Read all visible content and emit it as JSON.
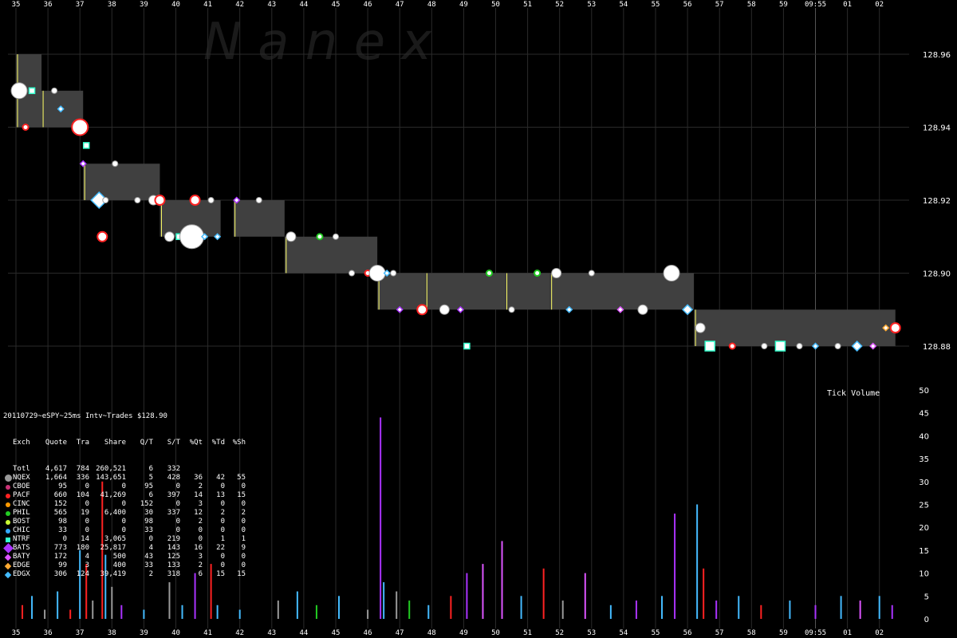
{
  "watermark": "N a n e x",
  "stats_title": "20110729~eSPY~25ms Intv~Trades $128.90",
  "stats_header": [
    "Exch",
    "Quote",
    "Tra",
    "Share",
    "Q/T",
    "S/T",
    "%Qt",
    "%Td",
    "%Sh"
  ],
  "stats_rows": [
    {
      "exch": "Totl",
      "quote": "4,617",
      "tra": "784",
      "share": "260,521",
      "qt": "6",
      "st": "332",
      "pqt": "",
      "ptd": "",
      "psh": "",
      "color": "",
      "marker": "none"
    },
    {
      "exch": "NQEX",
      "quote": "1,664",
      "tra": "336",
      "share": "143,651",
      "qt": "5",
      "st": "428",
      "pqt": "36",
      "ptd": "42",
      "psh": "55",
      "color": "#999999",
      "marker": "circle-big"
    },
    {
      "exch": "CBOE",
      "quote": "95",
      "tra": "0",
      "share": "0",
      "qt": "95",
      "st": "0",
      "pqt": "2",
      "ptd": "0",
      "psh": "0",
      "color": "#cc3377",
      "marker": "circle"
    },
    {
      "exch": "PACF",
      "quote": "660",
      "tra": "104",
      "share": "41,269",
      "qt": "6",
      "st": "397",
      "pqt": "14",
      "ptd": "13",
      "psh": "15",
      "color": "#ff2222",
      "marker": "circle"
    },
    {
      "exch": "CINC",
      "quote": "152",
      "tra": "0",
      "share": "0",
      "qt": "152",
      "st": "0",
      "pqt": "3",
      "ptd": "0",
      "psh": "0",
      "color": "#ff9900",
      "marker": "circle"
    },
    {
      "exch": "PHIL",
      "quote": "565",
      "tra": "19",
      "share": "6,400",
      "qt": "30",
      "st": "337",
      "pqt": "12",
      "ptd": "2",
      "psh": "2",
      "color": "#22cc22",
      "marker": "circle"
    },
    {
      "exch": "BOST",
      "quote": "98",
      "tra": "0",
      "share": "0",
      "qt": "98",
      "st": "0",
      "pqt": "2",
      "ptd": "0",
      "psh": "0",
      "color": "#ccff33",
      "marker": "circle"
    },
    {
      "exch": "CHIC",
      "quote": "33",
      "tra": "0",
      "share": "0",
      "qt": "33",
      "st": "0",
      "pqt": "0",
      "ptd": "0",
      "psh": "0",
      "color": "#33aaff",
      "marker": "circle"
    },
    {
      "exch": "NTRF",
      "quote": "0",
      "tra": "14",
      "share": "3,065",
      "qt": "0",
      "st": "219",
      "pqt": "0",
      "ptd": "1",
      "psh": "1",
      "color": "#33ffcc",
      "marker": "square"
    },
    {
      "exch": "BATS",
      "quote": "773",
      "tra": "180",
      "share": "25,817",
      "qt": "4",
      "st": "143",
      "pqt": "16",
      "ptd": "22",
      "psh": "9",
      "color": "#aa33ff",
      "marker": "diamond-big"
    },
    {
      "exch": "BATY",
      "quote": "172",
      "tra": "4",
      "share": "500",
      "qt": "43",
      "st": "125",
      "pqt": "3",
      "ptd": "0",
      "psh": "0",
      "color": "#dd55ff",
      "marker": "diamond"
    },
    {
      "exch": "EDGE",
      "quote": "99",
      "tra": "3",
      "share": "400",
      "qt": "33",
      "st": "133",
      "pqt": "2",
      "ptd": "0",
      "psh": "0",
      "color": "#ffaa33",
      "marker": "diamond"
    },
    {
      "exch": "EDGX",
      "quote": "306",
      "tra": "124",
      "share": "39,419",
      "qt": "2",
      "st": "318",
      "pqt": "6",
      "ptd": "15",
      "psh": "15",
      "color": "#44bbff",
      "marker": "diamond"
    }
  ],
  "chart_data": [
    {
      "type": "scatter",
      "x_tick_labels": [
        "35",
        "36",
        "37",
        "38",
        "39",
        "40",
        "41",
        "42",
        "43",
        "44",
        "45",
        "46",
        "47",
        "48",
        "49",
        "50",
        "51",
        "52",
        "53",
        "54",
        "55",
        "56",
        "57",
        "58",
        "59",
        "09:55",
        "01",
        "02"
      ],
      "y_tick_labels": [
        "128.96",
        "128.94",
        "128.92",
        "128.90",
        "128.88"
      ],
      "ylim": [
        128.875,
        128.97
      ],
      "nbbo_spread": [
        {
          "t0": 0.0,
          "t1": 0.8,
          "bid": 128.94,
          "ask": 128.96
        },
        {
          "t0": 0.8,
          "t1": 2.1,
          "bid": 128.94,
          "ask": 128.95
        },
        {
          "t0": 2.1,
          "t1": 4.5,
          "bid": 128.92,
          "ask": 128.93
        },
        {
          "t0": 4.5,
          "t1": 6.4,
          "bid": 128.91,
          "ask": 128.92
        },
        {
          "t0": 6.8,
          "t1": 8.4,
          "bid": 128.91,
          "ask": 128.92
        },
        {
          "t0": 8.4,
          "t1": 11.3,
          "bid": 128.9,
          "ask": 128.91
        },
        {
          "t0": 11.3,
          "t1": 12.8,
          "bid": 128.89,
          "ask": 128.9
        },
        {
          "t0": 12.8,
          "t1": 15.3,
          "bid": 128.89,
          "ask": 128.9
        },
        {
          "t0": 15.3,
          "t1": 16.7,
          "bid": 128.89,
          "ask": 128.9
        },
        {
          "t0": 16.7,
          "t1": 21.2,
          "bid": 128.89,
          "ask": 128.9
        },
        {
          "t0": 21.2,
          "t1": 27.5,
          "bid": 128.88,
          "ask": 128.89
        }
      ],
      "trades": [
        {
          "t": 0.1,
          "p": 128.95,
          "exch": "NQEX",
          "size": "l"
        },
        {
          "t": 0.3,
          "p": 128.94,
          "exch": "PACF",
          "size": "s"
        },
        {
          "t": 0.5,
          "p": 128.95,
          "exch": "NTRF",
          "size": "s"
        },
        {
          "t": 1.2,
          "p": 128.95,
          "exch": "NQEX",
          "size": "s"
        },
        {
          "t": 1.4,
          "p": 128.945,
          "exch": "EDGX",
          "size": "s"
        },
        {
          "t": 2.0,
          "p": 128.94,
          "exch": "PACF",
          "size": "l"
        },
        {
          "t": 2.2,
          "p": 128.935,
          "exch": "NTRF",
          "size": "s"
        },
        {
          "t": 2.1,
          "p": 128.93,
          "exch": "BATS",
          "size": "s"
        },
        {
          "t": 2.6,
          "p": 128.92,
          "exch": "EDGX",
          "size": "l"
        },
        {
          "t": 2.8,
          "p": 128.92,
          "exch": "NQEX",
          "size": "s"
        },
        {
          "t": 2.7,
          "p": 128.91,
          "exch": "PACF",
          "size": "m"
        },
        {
          "t": 3.1,
          "p": 128.93,
          "exch": "NQEX",
          "size": "s"
        },
        {
          "t": 3.8,
          "p": 128.92,
          "exch": "NQEX",
          "size": "s"
        },
        {
          "t": 4.3,
          "p": 128.92,
          "exch": "NQEX",
          "size": "m"
        },
        {
          "t": 4.5,
          "p": 128.92,
          "exch": "PACF",
          "size": "m"
        },
        {
          "t": 4.8,
          "p": 128.91,
          "exch": "NQEX",
          "size": "m"
        },
        {
          "t": 5.1,
          "p": 128.91,
          "exch": "NTRF",
          "size": "s"
        },
        {
          "t": 5.5,
          "p": 128.91,
          "exch": "NQEX",
          "size": "xl"
        },
        {
          "t": 5.9,
          "p": 128.91,
          "exch": "EDGX",
          "size": "s"
        },
        {
          "t": 6.3,
          "p": 128.91,
          "exch": "EDGX",
          "size": "s"
        },
        {
          "t": 5.6,
          "p": 128.92,
          "exch": "PACF",
          "size": "m"
        },
        {
          "t": 6.1,
          "p": 128.92,
          "exch": "NQEX",
          "size": "s"
        },
        {
          "t": 6.9,
          "p": 128.92,
          "exch": "BATS",
          "size": "s"
        },
        {
          "t": 7.6,
          "p": 128.92,
          "exch": "NQEX",
          "size": "s"
        },
        {
          "t": 8.6,
          "p": 128.91,
          "exch": "NQEX",
          "size": "m"
        },
        {
          "t": 9.5,
          "p": 128.91,
          "exch": "PHIL",
          "size": "s"
        },
        {
          "t": 10.0,
          "p": 128.91,
          "exch": "NQEX",
          "size": "s"
        },
        {
          "t": 10.5,
          "p": 128.9,
          "exch": "NQEX",
          "size": "s"
        },
        {
          "t": 11.0,
          "p": 128.9,
          "exch": "PACF",
          "size": "s"
        },
        {
          "t": 11.3,
          "p": 128.9,
          "exch": "NQEX",
          "size": "l"
        },
        {
          "t": 11.6,
          "p": 128.9,
          "exch": "EDGX",
          "size": "s"
        },
        {
          "t": 11.8,
          "p": 128.9,
          "exch": "NQEX",
          "size": "s"
        },
        {
          "t": 12.0,
          "p": 128.89,
          "exch": "BATS",
          "size": "s"
        },
        {
          "t": 12.7,
          "p": 128.89,
          "exch": "PACF",
          "size": "m"
        },
        {
          "t": 13.4,
          "p": 128.89,
          "exch": "NQEX",
          "size": "m"
        },
        {
          "t": 13.9,
          "p": 128.89,
          "exch": "BATS",
          "size": "s"
        },
        {
          "t": 14.1,
          "p": 128.88,
          "exch": "NTRF",
          "size": "s"
        },
        {
          "t": 14.8,
          "p": 128.9,
          "exch": "PHIL",
          "size": "s"
        },
        {
          "t": 15.5,
          "p": 128.89,
          "exch": "NQEX",
          "size": "s"
        },
        {
          "t": 16.3,
          "p": 128.9,
          "exch": "PHIL",
          "size": "s"
        },
        {
          "t": 16.9,
          "p": 128.9,
          "exch": "NQEX",
          "size": "m"
        },
        {
          "t": 17.3,
          "p": 128.89,
          "exch": "EDGX",
          "size": "s"
        },
        {
          "t": 18.0,
          "p": 128.9,
          "exch": "NQEX",
          "size": "s"
        },
        {
          "t": 18.9,
          "p": 128.89,
          "exch": "BATY",
          "size": "s"
        },
        {
          "t": 19.6,
          "p": 128.89,
          "exch": "NQEX",
          "size": "m"
        },
        {
          "t": 20.5,
          "p": 128.9,
          "exch": "NQEX",
          "size": "l"
        },
        {
          "t": 21.0,
          "p": 128.89,
          "exch": "EDGX",
          "size": "m"
        },
        {
          "t": 21.4,
          "p": 128.885,
          "exch": "NQEX",
          "size": "m"
        },
        {
          "t": 21.7,
          "p": 128.88,
          "exch": "NTRF",
          "size": "m"
        },
        {
          "t": 22.4,
          "p": 128.88,
          "exch": "PACF",
          "size": "s"
        },
        {
          "t": 23.4,
          "p": 128.88,
          "exch": "NQEX",
          "size": "s"
        },
        {
          "t": 23.9,
          "p": 128.88,
          "exch": "NTRF",
          "size": "m"
        },
        {
          "t": 24.5,
          "p": 128.88,
          "exch": "NQEX",
          "size": "s"
        },
        {
          "t": 25.0,
          "p": 128.88,
          "exch": "EDGX",
          "size": "s"
        },
        {
          "t": 25.7,
          "p": 128.88,
          "exch": "NQEX",
          "size": "s"
        },
        {
          "t": 26.3,
          "p": 128.88,
          "exch": "EDGX",
          "size": "m"
        },
        {
          "t": 26.8,
          "p": 128.88,
          "exch": "BATY",
          "size": "s"
        },
        {
          "t": 27.2,
          "p": 128.885,
          "exch": "EDGE",
          "size": "s"
        },
        {
          "t": 27.5,
          "p": 128.885,
          "exch": "PACF",
          "size": "m"
        }
      ]
    },
    {
      "type": "bar",
      "title": "Tick Volume",
      "y_tick_labels": [
        "50",
        "45",
        "40",
        "35",
        "30",
        "25",
        "20",
        "15",
        "10",
        "5",
        "0"
      ],
      "ylim": [
        0,
        50
      ],
      "bars": [
        {
          "t": 0.2,
          "v": 3,
          "exch": "PACF"
        },
        {
          "t": 0.5,
          "v": 5,
          "exch": "EDGX"
        },
        {
          "t": 0.9,
          "v": 2,
          "exch": "NQEX"
        },
        {
          "t": 1.3,
          "v": 6,
          "exch": "EDGX"
        },
        {
          "t": 1.7,
          "v": 2,
          "exch": "PACF"
        },
        {
          "t": 2.0,
          "v": 15,
          "exch": "EDGX"
        },
        {
          "t": 2.2,
          "v": 12,
          "exch": "PACF"
        },
        {
          "t": 2.4,
          "v": 4,
          "exch": "NQEX"
        },
        {
          "t": 2.7,
          "v": 30,
          "exch": "PACF"
        },
        {
          "t": 2.8,
          "v": 14,
          "exch": "EDGX"
        },
        {
          "t": 3.0,
          "v": 7,
          "exch": "NQEX"
        },
        {
          "t": 3.3,
          "v": 3,
          "exch": "BATS"
        },
        {
          "t": 4.0,
          "v": 2,
          "exch": "EDGX"
        },
        {
          "t": 4.8,
          "v": 8,
          "exch": "NQEX"
        },
        {
          "t": 5.2,
          "v": 3,
          "exch": "EDGX"
        },
        {
          "t": 5.6,
          "v": 10,
          "exch": "BATS"
        },
        {
          "t": 6.1,
          "v": 12,
          "exch": "PACF"
        },
        {
          "t": 6.3,
          "v": 3,
          "exch": "EDGX"
        },
        {
          "t": 7.0,
          "v": 2,
          "exch": "EDGX"
        },
        {
          "t": 8.2,
          "v": 4,
          "exch": "NQEX"
        },
        {
          "t": 8.8,
          "v": 6,
          "exch": "EDGX"
        },
        {
          "t": 9.4,
          "v": 3,
          "exch": "PHIL"
        },
        {
          "t": 10.1,
          "v": 5,
          "exch": "EDGX"
        },
        {
          "t": 11.0,
          "v": 2,
          "exch": "NQEX"
        },
        {
          "t": 11.4,
          "v": 44,
          "exch": "BATS"
        },
        {
          "t": 11.5,
          "v": 8,
          "exch": "EDGX"
        },
        {
          "t": 11.9,
          "v": 6,
          "exch": "NQEX"
        },
        {
          "t": 12.3,
          "v": 4,
          "exch": "PHIL"
        },
        {
          "t": 12.9,
          "v": 3,
          "exch": "EDGX"
        },
        {
          "t": 13.6,
          "v": 5,
          "exch": "PACF"
        },
        {
          "t": 14.1,
          "v": 10,
          "exch": "BATS"
        },
        {
          "t": 14.6,
          "v": 12,
          "exch": "BATY"
        },
        {
          "t": 15.2,
          "v": 17,
          "exch": "BATY"
        },
        {
          "t": 15.8,
          "v": 5,
          "exch": "EDGX"
        },
        {
          "t": 16.5,
          "v": 11,
          "exch": "PACF"
        },
        {
          "t": 17.1,
          "v": 4,
          "exch": "NQEX"
        },
        {
          "t": 17.8,
          "v": 10,
          "exch": "BATY"
        },
        {
          "t": 18.6,
          "v": 3,
          "exch": "EDGX"
        },
        {
          "t": 19.4,
          "v": 4,
          "exch": "BATS"
        },
        {
          "t": 20.2,
          "v": 5,
          "exch": "EDGX"
        },
        {
          "t": 20.6,
          "v": 23,
          "exch": "BATS"
        },
        {
          "t": 21.3,
          "v": 25,
          "exch": "EDGX"
        },
        {
          "t": 21.5,
          "v": 11,
          "exch": "PACF"
        },
        {
          "t": 21.9,
          "v": 4,
          "exch": "BATS"
        },
        {
          "t": 22.6,
          "v": 5,
          "exch": "EDGX"
        },
        {
          "t": 23.3,
          "v": 3,
          "exch": "PACF"
        },
        {
          "t": 24.2,
          "v": 4,
          "exch": "EDGX"
        },
        {
          "t": 25.0,
          "v": 3,
          "exch": "BATS"
        },
        {
          "t": 25.8,
          "v": 5,
          "exch": "EDGX"
        },
        {
          "t": 26.4,
          "v": 4,
          "exch": "BATY"
        },
        {
          "t": 27.0,
          "v": 5,
          "exch": "EDGX"
        },
        {
          "t": 27.4,
          "v": 3,
          "exch": "BATS"
        }
      ]
    }
  ],
  "volume_label": "Tick Volume"
}
